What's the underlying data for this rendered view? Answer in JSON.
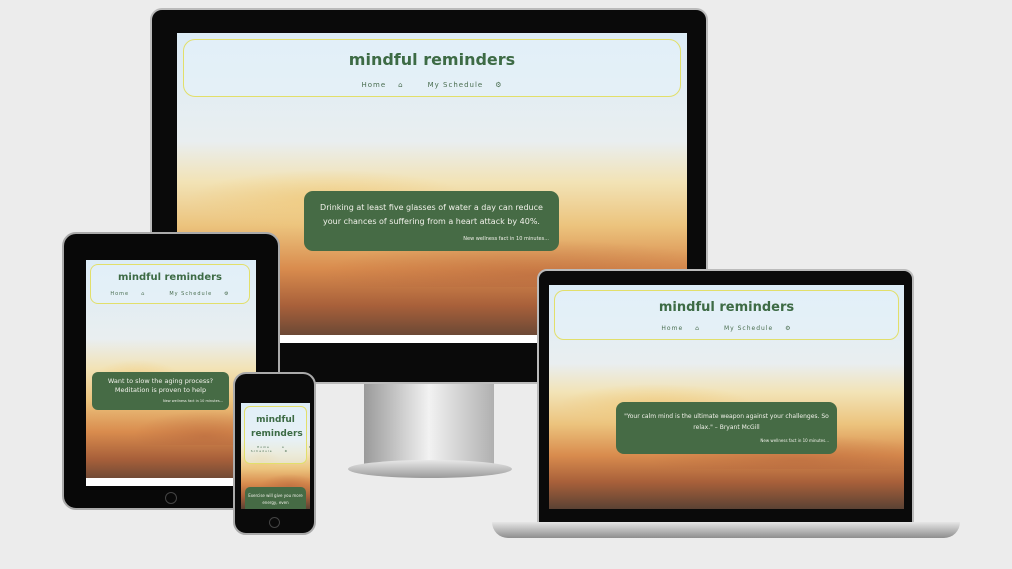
{
  "site": {
    "title": "mindful reminders",
    "nav": [
      {
        "label": "Home",
        "icon": "home-icon"
      },
      {
        "label": "My Schedule",
        "icon": "gear-icon"
      }
    ],
    "countdown": "New wellness fact in 10 minutes..."
  },
  "desktop": {
    "fact": "Drinking at least five glasses of water a day can reduce your chances of suffering from a heart attack by 40%."
  },
  "tablet": {
    "fact": "Want to slow the aging process? Meditation is proven to help"
  },
  "laptop": {
    "fact": "\"Your calm mind is the ultimate weapon against your challenges. So relax.\" – Bryant McGill"
  },
  "phone": {
    "fact": "Exercise will give you more energy, even"
  },
  "colors": {
    "card": "#466b45",
    "title": "#3d6b45",
    "border": "#e2df6a"
  }
}
